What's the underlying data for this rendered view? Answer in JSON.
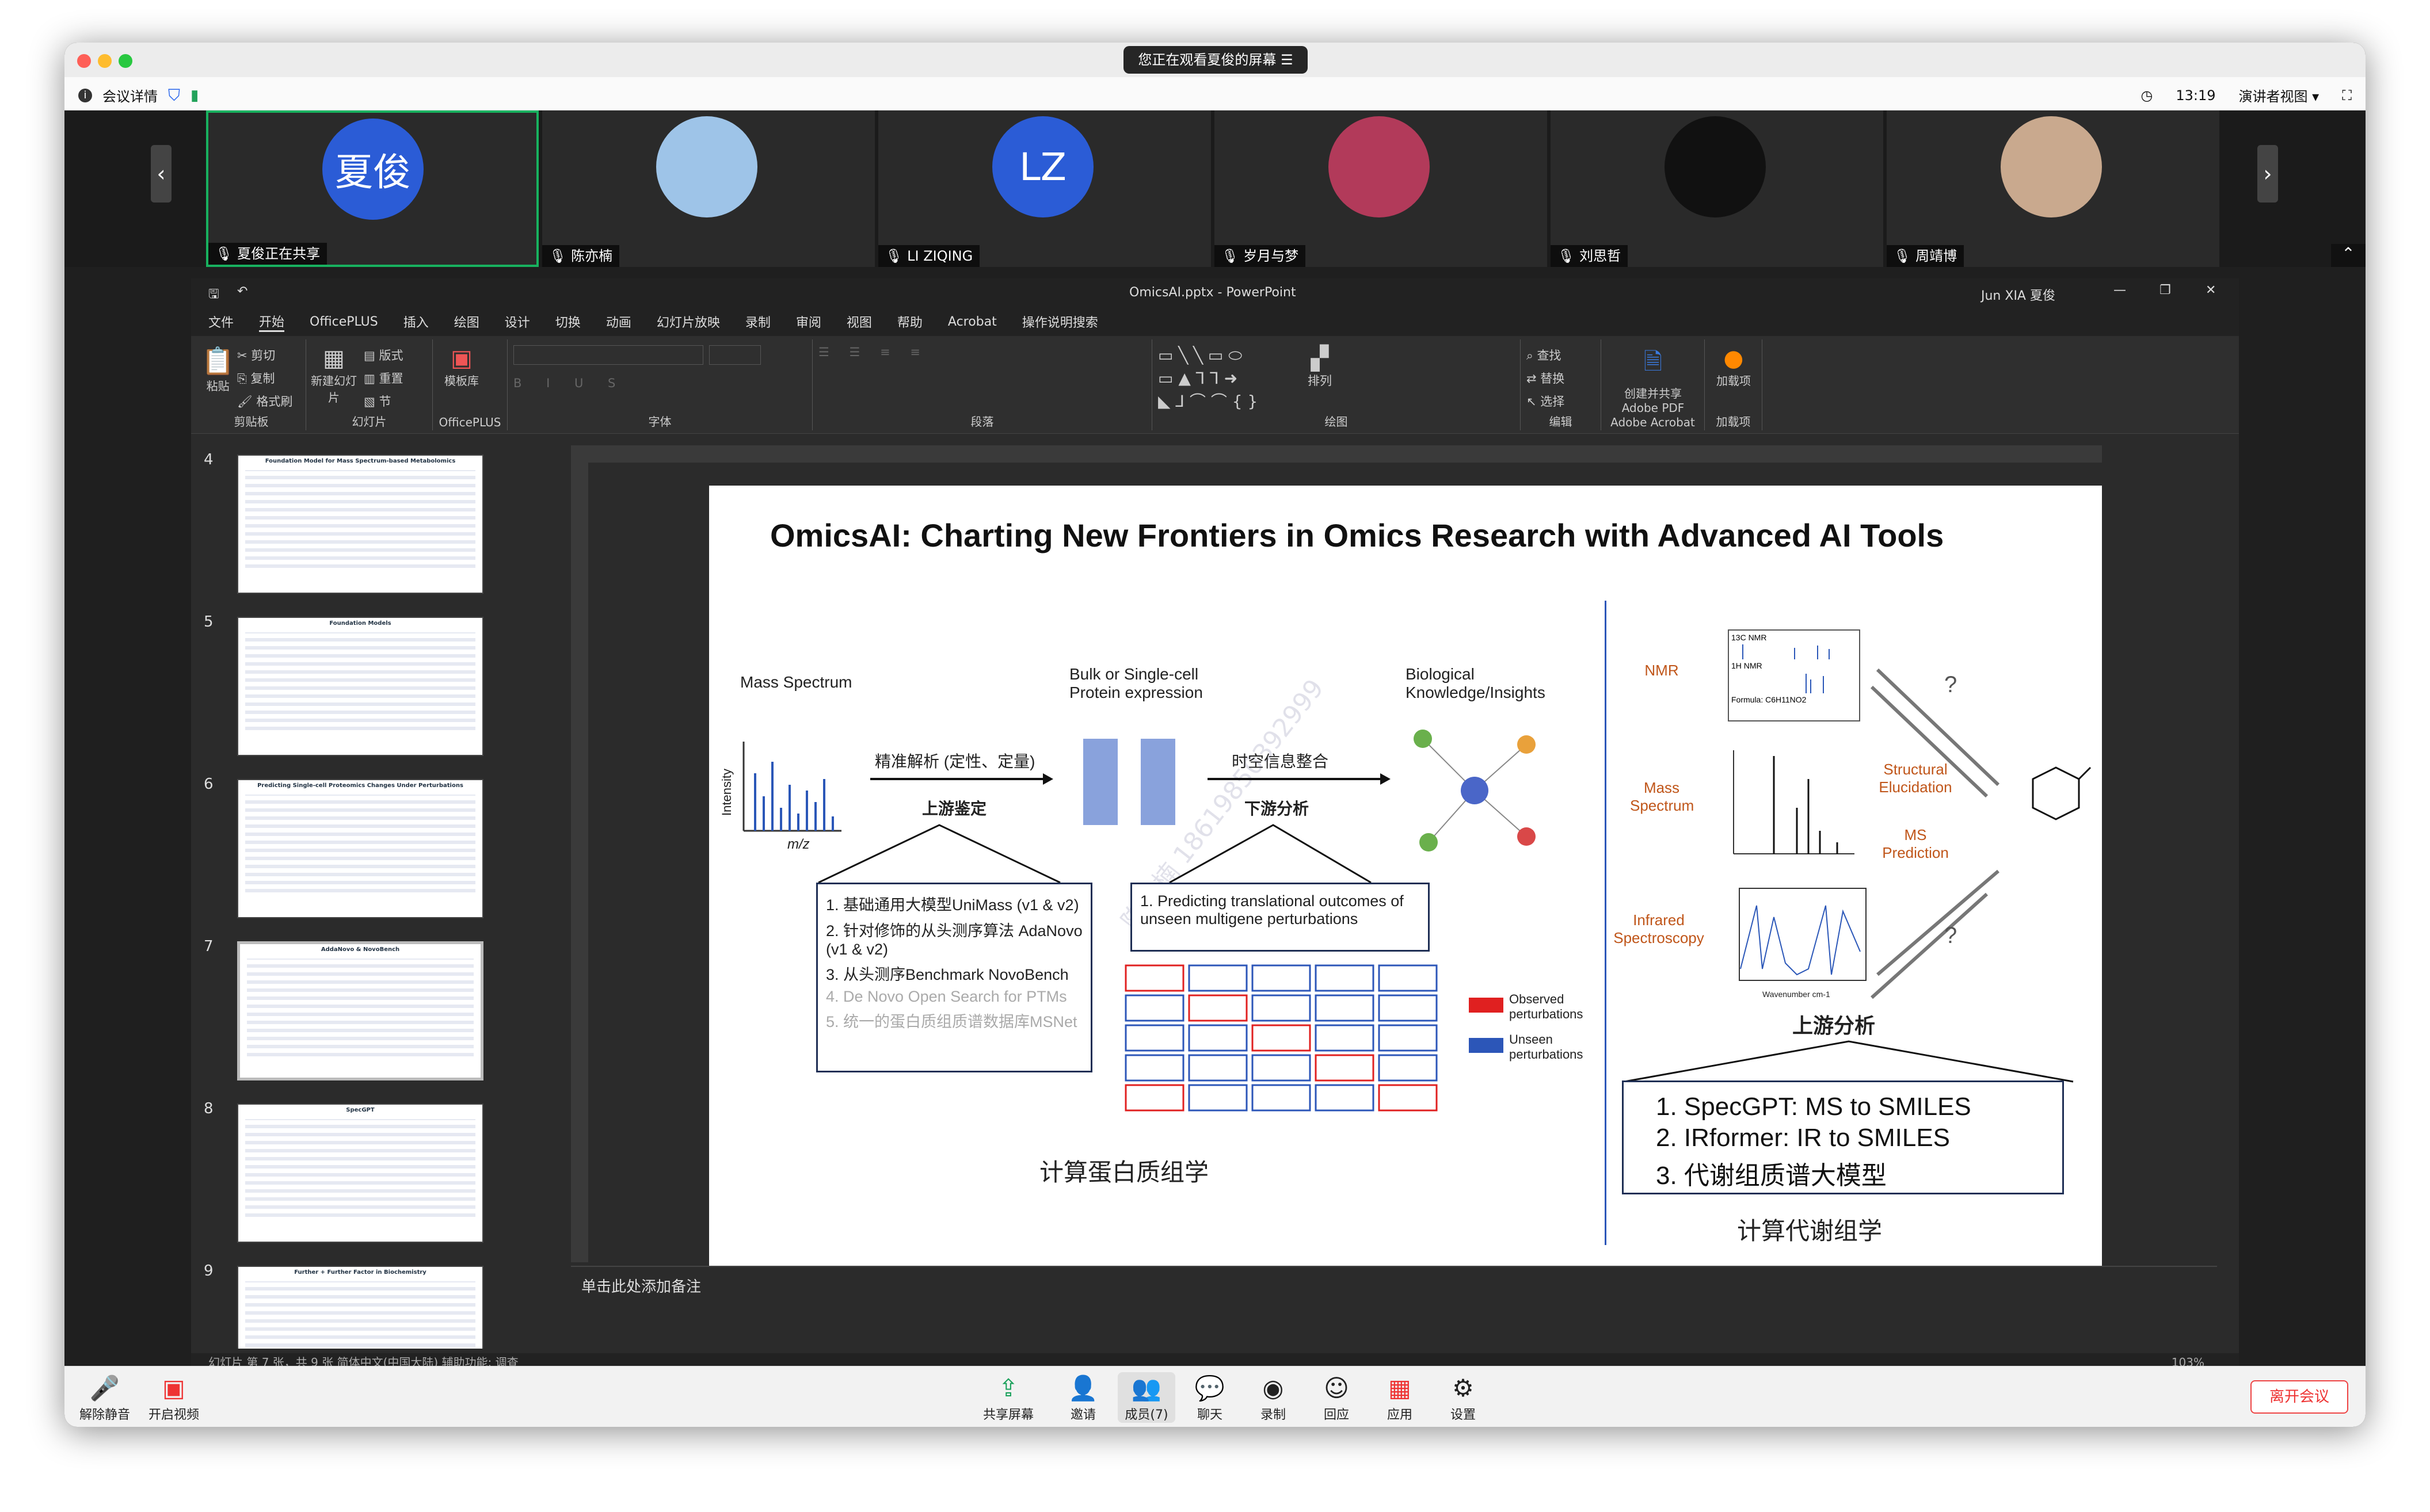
{
  "share_banner": "您正在观看夏俊的屏幕",
  "info": {
    "meeting_details": "会议详情",
    "time": "13:19",
    "view_mode": "演讲者视图"
  },
  "participants": [
    {
      "name": "夏俊正在共享",
      "avatar_text": "夏俊",
      "color": "#2b5cd6"
    },
    {
      "name": "陈亦楠",
      "avatar_text": "",
      "color": "#9ec4e8"
    },
    {
      "name": "LI ZIQING",
      "avatar_text": "LZ",
      "color": "#2b5cd6"
    },
    {
      "name": "岁月与梦",
      "avatar_text": "",
      "color": "#b23a5a"
    },
    {
      "name": "刘思哲",
      "avatar_text": "",
      "color": "#111111"
    },
    {
      "name": "周靖博",
      "avatar_text": "",
      "color": "#c9a98e"
    }
  ],
  "ppt": {
    "window_title": "OmicsAI.pptx  -  PowerPoint",
    "user": "Jun XIA 夏俊",
    "menu": [
      "文件",
      "开始",
      "OfficePLUS",
      "插入",
      "绘图",
      "设计",
      "切换",
      "动画",
      "幻灯片放映",
      "录制",
      "审阅",
      "视图",
      "帮助",
      "Acrobat",
      "操作说明搜索"
    ],
    "ribbon_groups": [
      "剪贴板",
      "幻灯片",
      "OfficePLUS",
      "字体",
      "段落",
      "绘图",
      "编辑",
      "Adobe Acrobat",
      "加载项"
    ],
    "ribbon_items": {
      "paste": "粘贴",
      "cut": "剪切",
      "copy": "复制",
      "format": "格式刷",
      "new_slide": "新建幻灯片",
      "layout": "版式",
      "reset": "重置",
      "section": "节",
      "template": "模板库",
      "arrange": "排列",
      "find": "查找",
      "replace": "替换",
      "select": "选择",
      "acrobat": "创建并共享 Adobe PDF",
      "addin": "加载项"
    },
    "thumbnail_numbers": [
      "4",
      "5",
      "6",
      "7",
      "8",
      "9"
    ],
    "thumbnail_titles": [
      "Foundation Model for Mass Spectrum-based Metabolomics",
      "Foundation Models",
      "Predicting Single-cell Proteomics Changes Under Perturbations",
      "AddaNovo & NovoBench",
      "SpecGPT",
      "Further + Further Factor in Biochemistry"
    ],
    "notes_placeholder": "单击此处添加备注",
    "status": "幻灯片 第 7 张，共 9 张    简体中文(中国大陆)    辅助功能: 调查",
    "zoom": "103%"
  },
  "slide": {
    "title": "OmicsAI: Charting New Frontiers in Omics Research with Advanced AI Tools",
    "mass_spectrum": "Mass Spectrum",
    "intensity": "Intensity",
    "mz": "m/z",
    "bulk": "Bulk or Single-cell Protein expression",
    "bio": "Biological Knowledge/Insights",
    "precise": "精准解析 (定性、定量)",
    "upstream": "上游鉴定",
    "spatio": "时空信息整合",
    "downstream": "下游分析",
    "list_left": [
      "1.  基础通用大模型UniMass (v1 & v2)",
      "2.  针对修饰的从头测序算法 AdaNovo (v1 & v2)",
      "3.  从头测序Benchmark NovoBench",
      "4.  De Novo Open Search for PTMs",
      "5.  统一的蛋白质组质谱数据库MSNet"
    ],
    "predict_text": "1. Predicting translational outcomes of unseen multigene perturbations",
    "observed": "Observed perturbations",
    "unseen": "Unseen perturbations",
    "comp_prot": "计算蛋白质组学",
    "nmr": "NMR",
    "mass2": "Mass Spectrum",
    "infrared": "Infrared Spectroscopy",
    "structural": "Structural Elucidation",
    "ms_pred": "MS Prediction",
    "question": "?",
    "upstream2": "上游分析",
    "list_right": [
      "1.  SpecGPT: MS to SMILES",
      "2.  IRformer: IR to SMILES",
      "3.  代谢组质谱大模型"
    ],
    "comp_metab": "计算代谢组学",
    "nmr_labels": [
      "13C NMR",
      "1H NMR",
      "Formula: C6H11NO2"
    ],
    "ir_axis": "Wavenumber cm-1",
    "watermark": "陈亦楠 18619850392999"
  },
  "toolbar": {
    "mute": "解除静音",
    "video": "开启视频",
    "share": "共享屏幕",
    "invite": "邀请",
    "members": "成员(7)",
    "chat": "聊天",
    "record": "录制",
    "reaction": "回应",
    "apps": "应用",
    "settings": "设置",
    "leave": "离开会议"
  }
}
